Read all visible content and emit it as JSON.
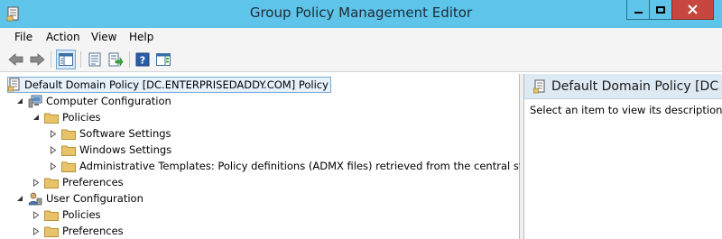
{
  "window": {
    "title": "Group Policy Management Editor"
  },
  "menu": {
    "items": [
      "File",
      "Action",
      "View",
      "Help"
    ]
  },
  "toolbar": {
    "buttons": [
      "back-icon",
      "forward-icon",
      "show-hide-console-tree-icon",
      "properties-icon",
      "export-list-icon",
      "help-icon",
      "show-hide-action-pane-icon"
    ]
  },
  "tree": {
    "root": "Default Domain Policy [DC.ENTERPRISEDADDY.COM] Policy",
    "computer_config": "Computer Configuration",
    "cc_policies": "Policies",
    "cc_software_settings": "Software Settings",
    "cc_windows_settings": "Windows Settings",
    "cc_admin_templates": "Administrative Templates: Policy definitions (ADMX files) retrieved from the central store.",
    "cc_preferences": "Preferences",
    "user_config": "User Configuration",
    "uc_policies": "Policies",
    "uc_preferences": "Preferences"
  },
  "details": {
    "header": "Default Domain Policy [DC",
    "description": "Select an item to view its description."
  },
  "colors": {
    "titlebar": "#5ec4ea",
    "close_button": "#c7463d",
    "folder": "#e8c36a",
    "selection_border": "#7aa7cf"
  }
}
